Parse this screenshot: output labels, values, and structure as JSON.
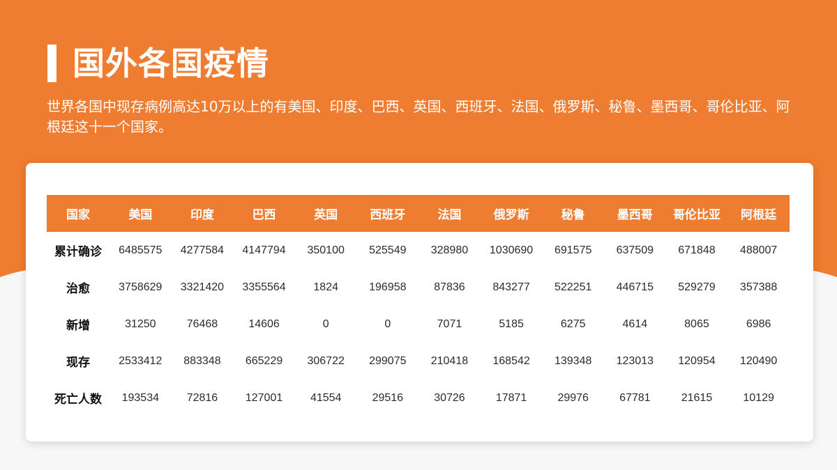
{
  "colors": {
    "accent": "#ee7c31",
    "background": "#f7f7f7",
    "card": "#ffffff"
  },
  "page": {
    "title": "国外各国疫情",
    "subtitle": "世界各国中现存病例高达10万以上的有美国、印度、巴西、英国、西班牙、法国、俄罗斯、秘鲁、墨西哥、哥伦比亚、阿根廷这十一个国家。"
  },
  "table": {
    "headers": [
      "国家",
      "美国",
      "印度",
      "巴西",
      "英国",
      "西班牙",
      "法国",
      "俄罗斯",
      "秘鲁",
      "墨西哥",
      "哥伦比亚",
      "阿根廷"
    ],
    "rows": [
      [
        "累计确诊",
        "6485575",
        "4277584",
        "4147794",
        "350100",
        "525549",
        "328980",
        "1030690",
        "691575",
        "637509",
        "671848",
        "488007"
      ],
      [
        "治愈",
        "3758629",
        "3321420",
        "3355564",
        "1824",
        "196958",
        "87836",
        "843277",
        "522251",
        "446715",
        "529279",
        "357388"
      ],
      [
        "新增",
        "31250",
        "76468",
        "14606",
        "0",
        "0",
        "7071",
        "5185",
        "6275",
        "4614",
        "8065",
        "6986"
      ],
      [
        "现存",
        "2533412",
        "883348",
        "665229",
        "306722",
        "299075",
        "210418",
        "168542",
        "139348",
        "123013",
        "120954",
        "120490"
      ],
      [
        "死亡人数",
        "193534",
        "72816",
        "127001",
        "41554",
        "29516",
        "30726",
        "17871",
        "29976",
        "67781",
        "21615",
        "10129"
      ]
    ]
  }
}
